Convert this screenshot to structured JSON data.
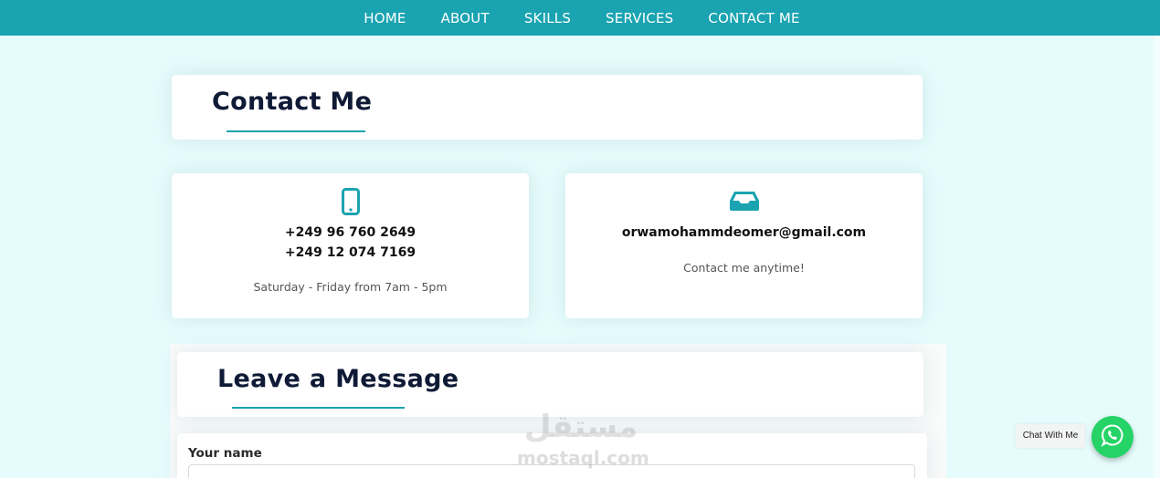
{
  "nav": {
    "items": [
      {
        "label": "HOME"
      },
      {
        "label": "ABOUT"
      },
      {
        "label": "SKILLS"
      },
      {
        "label": "SERVICES"
      },
      {
        "label": "CONTACT ME"
      }
    ]
  },
  "contact": {
    "title": "Contact Me"
  },
  "phone_card": {
    "icon": "mobile-phone-icon",
    "phone1": "+249 96 760 2649",
    "phone2": "+249 12 074 7169",
    "hours": "Saturday - Friday from 7am - 5pm"
  },
  "email_card": {
    "icon": "inbox-icon",
    "email": "orwamohammdeomer@gmail.com",
    "note": "Contact me anytime!"
  },
  "message": {
    "title": "Leave a Message",
    "name_label": "Your name",
    "name_value": ""
  },
  "watermark": {
    "arabic": "مستقل",
    "latin": "mostaql.com"
  },
  "chat": {
    "label": "Chat With Me",
    "icon": "whatsapp-icon"
  },
  "colors": {
    "accent": "#1aa3b1",
    "page_bg": "#e6fbfc",
    "heading": "#0f1a36",
    "whatsapp": "#25d366"
  }
}
